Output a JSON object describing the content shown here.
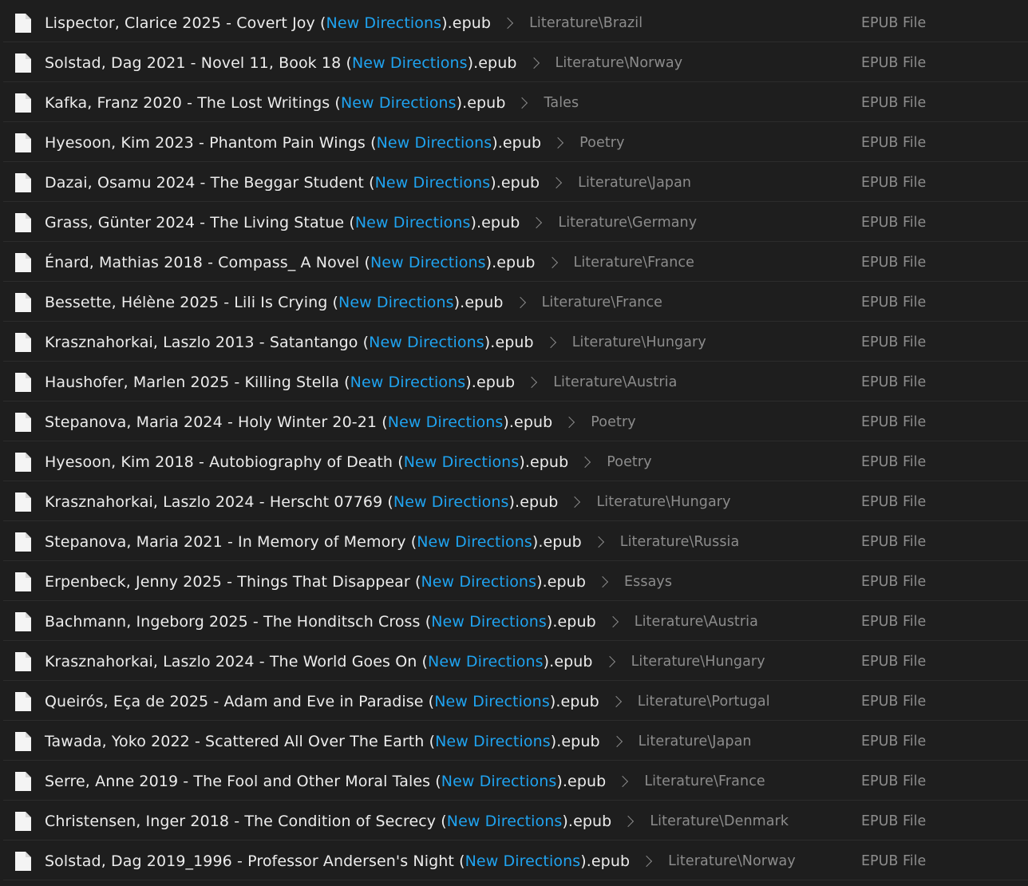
{
  "files": [
    {
      "name_prefix": "Lispector, Clarice 2025 - Covert Joy (",
      "publisher": "New Directions",
      "name_suffix": ").epub",
      "folder": "Literature\\Brazil",
      "type": "EPUB File"
    },
    {
      "name_prefix": "Solstad, Dag 2021 - Novel 11, Book 18 (",
      "publisher": "New Directions",
      "name_suffix": ").epub",
      "folder": "Literature\\Norway",
      "type": "EPUB File"
    },
    {
      "name_prefix": "Kafka, Franz 2020 - The Lost Writings (",
      "publisher": "New Directions",
      "name_suffix": ").epub",
      "folder": "Tales",
      "type": "EPUB File"
    },
    {
      "name_prefix": "Hyesoon, Kim 2023 - Phantom Pain Wings (",
      "publisher": "New Directions",
      "name_suffix": ").epub",
      "folder": "Poetry",
      "type": "EPUB File"
    },
    {
      "name_prefix": "Dazai, Osamu 2024 - The Beggar Student (",
      "publisher": "New Directions",
      "name_suffix": ").epub",
      "folder": "Literature\\Japan",
      "type": "EPUB File"
    },
    {
      "name_prefix": "Grass, Günter 2024 - The Living Statue (",
      "publisher": "New Directions",
      "name_suffix": ").epub",
      "folder": "Literature\\Germany",
      "type": "EPUB File"
    },
    {
      "name_prefix": "Énard, Mathias 2018 - Compass_ A Novel (",
      "publisher": "New Directions",
      "name_suffix": ").epub",
      "folder": "Literature\\France",
      "type": "EPUB File"
    },
    {
      "name_prefix": "Bessette, Hélène 2025 - Lili Is Crying (",
      "publisher": "New Directions",
      "name_suffix": ").epub",
      "folder": "Literature\\France",
      "type": "EPUB File"
    },
    {
      "name_prefix": "Krasznahorkai, Laszlo 2013 - Satantango (",
      "publisher": "New Directions",
      "name_suffix": ").epub",
      "folder": "Literature\\Hungary",
      "type": "EPUB File"
    },
    {
      "name_prefix": "Haushofer, Marlen 2025 - Killing Stella (",
      "publisher": "New Directions",
      "name_suffix": ").epub",
      "folder": "Literature\\Austria",
      "type": "EPUB File"
    },
    {
      "name_prefix": "Stepanova, Maria 2024 - Holy Winter 20-21 (",
      "publisher": "New Directions",
      "name_suffix": ").epub",
      "folder": "Poetry",
      "type": "EPUB File"
    },
    {
      "name_prefix": "Hyesoon, Kim 2018 - Autobiography of Death (",
      "publisher": "New Directions",
      "name_suffix": ").epub",
      "folder": "Poetry",
      "type": "EPUB File"
    },
    {
      "name_prefix": "Krasznahorkai, Laszlo 2024 - Herscht 07769 (",
      "publisher": "New Directions",
      "name_suffix": ").epub",
      "folder": "Literature\\Hungary",
      "type": "EPUB File"
    },
    {
      "name_prefix": "Stepanova, Maria 2021 - In Memory of Memory (",
      "publisher": "New Directions",
      "name_suffix": ").epub",
      "folder": "Literature\\Russia",
      "type": "EPUB File"
    },
    {
      "name_prefix": "Erpenbeck, Jenny 2025 - Things That Disappear (",
      "publisher": "New Directions",
      "name_suffix": ").epub",
      "folder": "Essays",
      "type": "EPUB File"
    },
    {
      "name_prefix": "Bachmann, Ingeborg 2025 - The Honditsch Cross (",
      "publisher": "New Directions",
      "name_suffix": ").epub",
      "folder": "Literature\\Austria",
      "type": "EPUB File"
    },
    {
      "name_prefix": "Krasznahorkai, Laszlo 2024 - The World Goes On (",
      "publisher": "New Directions",
      "name_suffix": ").epub",
      "folder": "Literature\\Hungary",
      "type": "EPUB File"
    },
    {
      "name_prefix": "Queirós, Eça de 2025 - Adam and Eve in Paradise (",
      "publisher": "New Directions",
      "name_suffix": ").epub",
      "folder": "Literature\\Portugal",
      "type": "EPUB File"
    },
    {
      "name_prefix": "Tawada, Yoko 2022 - Scattered All Over The Earth (",
      "publisher": "New Directions",
      "name_suffix": ").epub",
      "folder": "Literature\\Japan",
      "type": "EPUB File"
    },
    {
      "name_prefix": "Serre, Anne 2019 - The Fool and Other Moral Tales (",
      "publisher": "New Directions",
      "name_suffix": ").epub",
      "folder": "Literature\\France",
      "type": "EPUB File"
    },
    {
      "name_prefix": "Christensen, Inger 2018 - The Condition of Secrecy (",
      "publisher": "New Directions",
      "name_suffix": ").epub",
      "folder": "Literature\\Denmark",
      "type": "EPUB File"
    },
    {
      "name_prefix": "Solstad, Dag 2019_1996 - Professor Andersen's Night (",
      "publisher": "New Directions",
      "name_suffix": ").epub",
      "folder": "Literature\\Norway",
      "type": "EPUB File"
    }
  ],
  "icons": {
    "file": "file-icon",
    "separator": "chevron-right-icon"
  },
  "colors": {
    "background": "#1e1e1e",
    "filename": "#ececec",
    "publisher_highlight": "#1fa3f0",
    "secondary_text": "#8c8c8c",
    "row_divider": "#2c2c2c"
  }
}
